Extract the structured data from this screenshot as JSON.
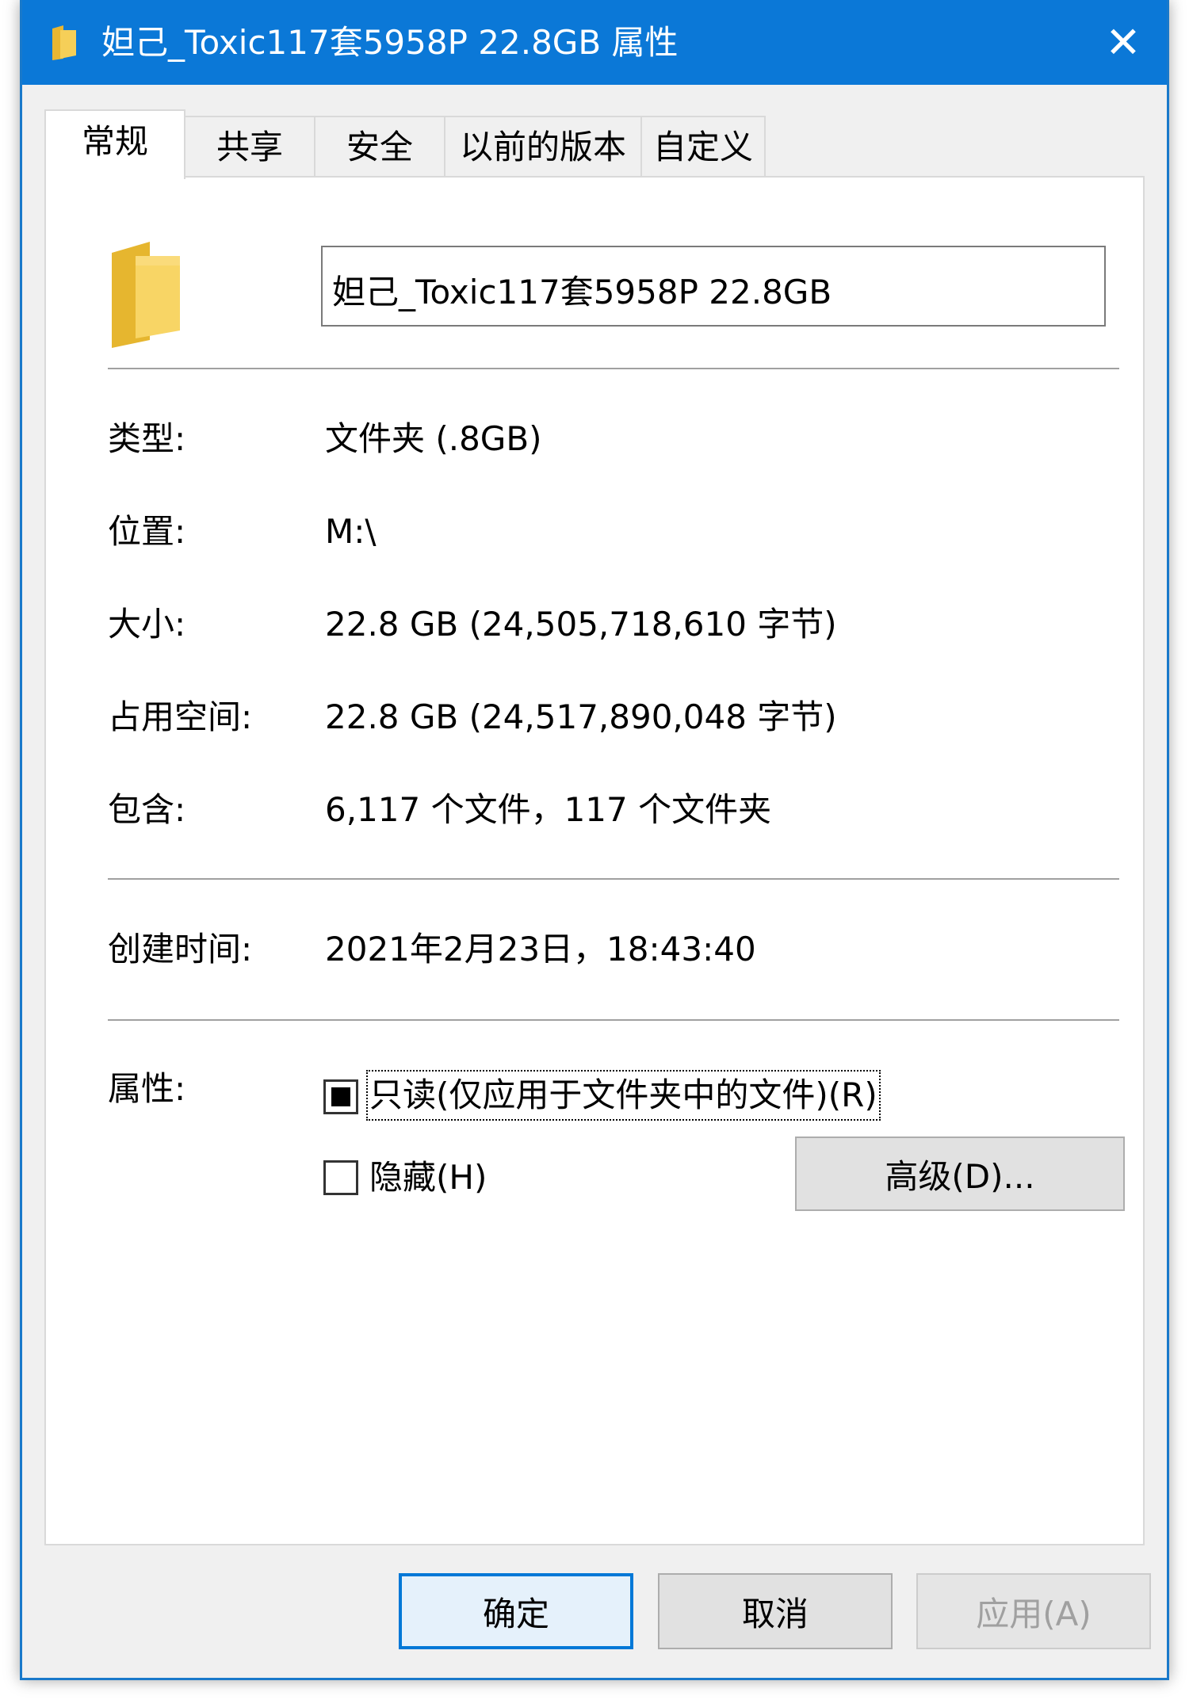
{
  "window": {
    "title": "妲己_Toxic117套5958P 22.8GB 属性",
    "close_glyph": "✕",
    "accent": "#0b78d7",
    "folder_color": "#f3c542"
  },
  "tabs": [
    {
      "label": "常规",
      "active": true
    },
    {
      "label": "共享",
      "active": false
    },
    {
      "label": "安全",
      "active": false
    },
    {
      "label": "以前的版本",
      "active": false
    },
    {
      "label": "自定义",
      "active": false
    }
  ],
  "general": {
    "name_value": "妲己_Toxic117套5958P 22.8GB",
    "type_label": "类型:",
    "type_value": "文件夹 (.8GB)",
    "location_label": "位置:",
    "location_value": "M:\\",
    "size_label": "大小:",
    "size_value": "22.8 GB (24,505,718,610 字节)",
    "disk_label": "占用空间:",
    "disk_value": "22.8 GB (24,517,890,048 字节)",
    "contains_label": "包含:",
    "contains_value": "6,117 个文件，117 个文件夹",
    "created_label": "创建时间:",
    "created_value": "2021年2月23日，18:43:40",
    "attributes_label": "属性:",
    "readonly_label": "只读(仅应用于文件夹中的文件)(R)",
    "readonly_state": "indeterminate",
    "hidden_label": "隐藏(H)",
    "hidden_checked": false,
    "advanced_label": "高级(D)..."
  },
  "footer": {
    "ok_label": "确定",
    "cancel_label": "取消",
    "apply_label": "应用(A)"
  }
}
